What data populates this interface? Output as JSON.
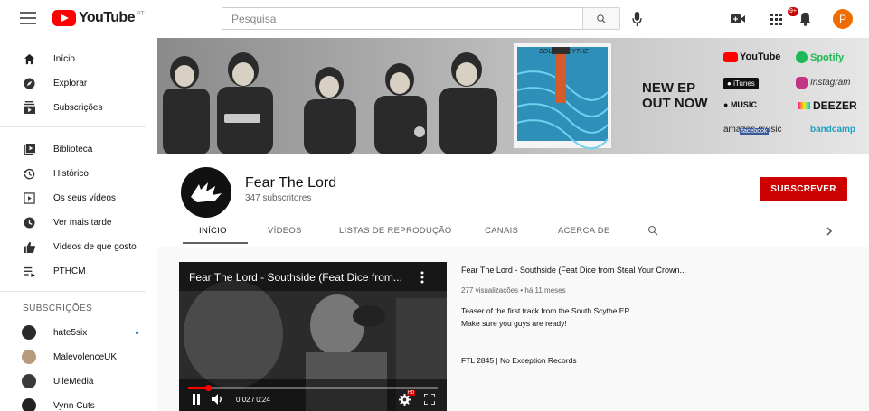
{
  "topbar": {
    "logo_text": "YouTube",
    "logo_region": "PT",
    "search_placeholder": "Pesquisa",
    "notifications_badge": "9+",
    "avatar_letter": "P"
  },
  "sidebar": {
    "main_items": [
      {
        "label": "Início",
        "icon": "home-icon"
      },
      {
        "label": "Explorar",
        "icon": "compass-icon"
      },
      {
        "label": "Subscrições",
        "icon": "subscriptions-icon"
      }
    ],
    "library_items": [
      {
        "label": "Biblioteca",
        "icon": "library-icon"
      },
      {
        "label": "Histórico",
        "icon": "history-icon"
      },
      {
        "label": "Os seus vídeos",
        "icon": "your-videos-icon"
      },
      {
        "label": "Ver mais tarde",
        "icon": "watch-later-icon"
      },
      {
        "label": "Vídeos de que gosto",
        "icon": "thumbs-up-icon"
      },
      {
        "label": "PTHCM",
        "icon": "playlist-icon"
      }
    ],
    "subscriptions_heading": "SUBSCRIÇÕES",
    "subscriptions": [
      {
        "name": "hate5six",
        "color": "#2b2b2b",
        "live": true
      },
      {
        "name": "MalevolenceUK",
        "color": "#b89a7c",
        "live": false
      },
      {
        "name": "UlleMedia",
        "color": "#3a3a3a",
        "live": false
      },
      {
        "name": "Vynn Cuts",
        "color": "#222222",
        "live": false
      }
    ]
  },
  "banner": {
    "headline_line1": "NEW EP",
    "headline_line2": "OUT NOW",
    "album_title": "SOUTH SCYTHE",
    "stores": [
      "YouTube",
      "Spotify",
      "iTunes",
      "Instagram",
      "MUSIC",
      "DEEZER",
      "amazon music",
      "facebook",
      "bandcamp"
    ]
  },
  "channel": {
    "name": "Fear The Lord",
    "subscribers": "347 subscritores",
    "subscribe_label": "SUBSCREVER",
    "tabs": [
      "INÍCIO",
      "VÍDEOS",
      "LISTAS DE REPRODUÇÃO",
      "CANAIS",
      "ACERCA DE"
    ],
    "active_tab": "INÍCIO"
  },
  "featured_video": {
    "player_title": "Fear The Lord - Southside (Feat Dice from...",
    "title": "Fear The Lord - Southside (Feat Dice from Steal Your Crown...",
    "meta": "277 visualizações • há 11 meses",
    "description_lines": [
      "Teaser of the first track from the South Scythe EP.",
      "Make sure you guys are ready!",
      "",
      "FTL 2845 | No Exception Records"
    ],
    "time_current": "0:02",
    "time_total": "0:24",
    "time_readout": "0:02 / 0:24",
    "progress_fraction": 0.083,
    "settings_badge": "HD"
  },
  "colors": {
    "brand_red": "#ff0000",
    "subscribe_red": "#cc0000",
    "avatar_orange": "#ef6c00",
    "spotify_green": "#1db954",
    "link_blue": "#065fd4"
  }
}
